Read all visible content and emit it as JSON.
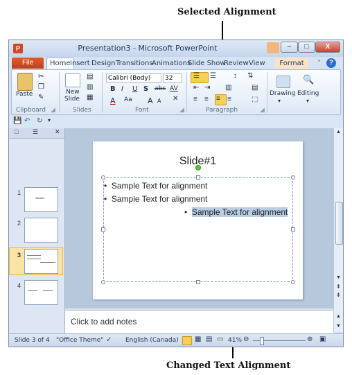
{
  "annotations": {
    "top": "Selected Alignment",
    "bottom": "Changed Text Alignment"
  },
  "window": {
    "title": "Presentation3 - Microsoft PowerPoint",
    "app_icon": "P",
    "minimize": "–",
    "maximize": "□",
    "close": "X"
  },
  "ribbon_tabs": {
    "file": "File",
    "items": [
      "Home",
      "Insert",
      "Design",
      "Transitions",
      "Animations",
      "Slide Show",
      "Review",
      "View"
    ],
    "active": "Home",
    "contextual": "Format"
  },
  "ribbon": {
    "clipboard_label": "Clipboard",
    "paste_label": "Paste",
    "slides_label": "Slides",
    "new_slide_label_1": "New",
    "new_slide_label_2": "Slide",
    "font_label": "Font",
    "font_name": "Calibri (Body)",
    "font_size": "32",
    "bold": "B",
    "italic": "I",
    "underline": "U",
    "shadow": "S",
    "strike": "abc",
    "spacing": "AV",
    "font_color": "A",
    "change_case": "Aa",
    "grow": "A",
    "shrink": "A",
    "paragraph_label": "Paragraph",
    "drawing_label": "Drawing",
    "editing_label": "Editing",
    "selected_alignment": "Align Text Right"
  },
  "slides_panel": {
    "thumbs": [
      {
        "num": "1",
        "caption": "Slide#1"
      },
      {
        "num": "2",
        "caption": ""
      },
      {
        "num": "3",
        "caption": ""
      },
      {
        "num": "4",
        "caption": ""
      }
    ],
    "selected": "3"
  },
  "slide": {
    "title": "Slide#1",
    "bullets": [
      {
        "text": "Sample Text for alignment",
        "align": "left"
      },
      {
        "text": "Sample Text for alignment",
        "align": "left"
      },
      {
        "text": "Sample Text for alignment",
        "align": "right"
      }
    ]
  },
  "notes": {
    "placeholder": "Click to add notes"
  },
  "status": {
    "slide_info": "Slide 3 of 4",
    "theme": "\"Office Theme\"",
    "language": "English (Canada)",
    "zoom": "41%"
  },
  "colors": {
    "selected_text_bg": "#b9cde5",
    "active_button": "#f6cf55",
    "file_tab": "#d24726"
  }
}
